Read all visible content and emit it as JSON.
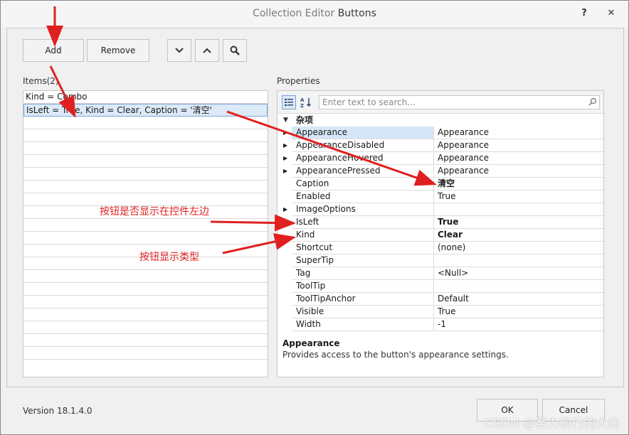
{
  "window": {
    "title_prefix": "Collection Editor",
    "title_main": "Buttons",
    "help_label": "?",
    "close_label": "✕"
  },
  "toolbar": {
    "add_label": "Add",
    "remove_label": "Remove",
    "down_label": "⌄",
    "up_label": "⌃",
    "search_icon": "magnifier-icon"
  },
  "items": {
    "header": "Items(2)",
    "rows": [
      "Kind = Combo",
      "IsLeft = True, Kind = Clear, Caption = '清空'"
    ]
  },
  "properties": {
    "header": "Properties",
    "search_placeholder": "Enter text to search...",
    "category": "杂项",
    "rows": [
      {
        "name": "Appearance",
        "value": "Appearance",
        "expandable": true,
        "bold": false
      },
      {
        "name": "AppearanceDisabled",
        "value": "Appearance",
        "expandable": true,
        "bold": false
      },
      {
        "name": "AppearanceHovered",
        "value": "Appearance",
        "expandable": true,
        "bold": false
      },
      {
        "name": "AppearancePressed",
        "value": "Appearance",
        "expandable": true,
        "bold": false
      },
      {
        "name": "Caption",
        "value": "清空",
        "expandable": false,
        "bold": true
      },
      {
        "name": "Enabled",
        "value": "True",
        "expandable": false,
        "bold": false
      },
      {
        "name": "ImageOptions",
        "value": "",
        "expandable": true,
        "bold": false
      },
      {
        "name": "IsLeft",
        "value": "True",
        "expandable": false,
        "bold": true
      },
      {
        "name": "Kind",
        "value": "Clear",
        "expandable": false,
        "bold": true
      },
      {
        "name": "Shortcut",
        "value": "(none)",
        "expandable": false,
        "bold": false
      },
      {
        "name": "SuperTip",
        "value": "",
        "expandable": false,
        "bold": false
      },
      {
        "name": "Tag",
        "value": "<Null>",
        "expandable": false,
        "bold": false
      },
      {
        "name": "ToolTip",
        "value": "",
        "expandable": false,
        "bold": false
      },
      {
        "name": "ToolTipAnchor",
        "value": "Default",
        "expandable": false,
        "bold": false
      },
      {
        "name": "Visible",
        "value": "True",
        "expandable": false,
        "bold": false
      },
      {
        "name": "Width",
        "value": "-1",
        "expandable": false,
        "bold": false
      }
    ],
    "description_title": "Appearance",
    "description_text": "Provides access to the button's appearance settings."
  },
  "footer": {
    "version": "Version 18.1.4.0",
    "ok_label": "OK",
    "cancel_label": "Cancel"
  },
  "annotations": {
    "isleft_note": "按钮是否显示在控件左边",
    "kind_note": "按钮显示类型",
    "arrow_color": "#e02020"
  },
  "watermark": "CSDN @努力前行的大白"
}
